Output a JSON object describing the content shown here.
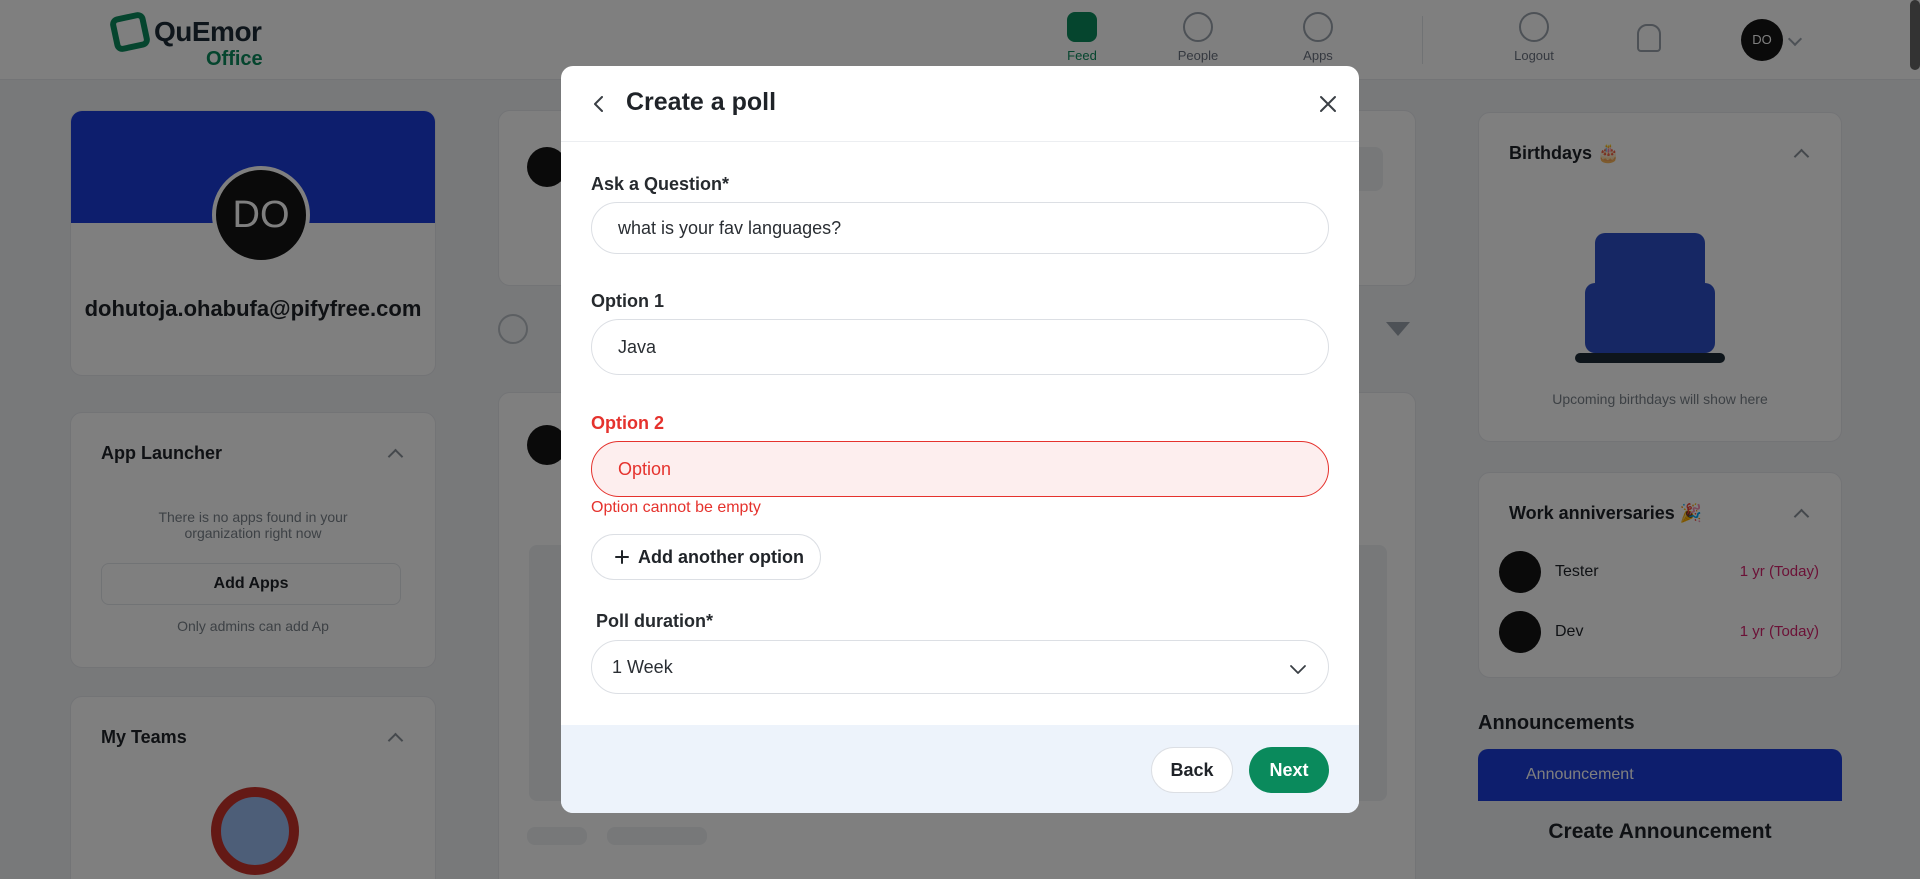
{
  "app": {
    "logo_name": "QuEmor",
    "logo_sub": "Office",
    "nav": [
      "Feed",
      "People",
      "Apps"
    ],
    "logout_label": "Logout",
    "user_initials": "DO"
  },
  "profile": {
    "initials": "DO",
    "email": "dohutoja.ohabufa@pifyfree.com"
  },
  "app_launcher": {
    "title": "App Launcher",
    "description": "There is no apps found in your organization right now",
    "button_label": "Add Apps",
    "note": "Only admins can add Ap"
  },
  "my_teams": {
    "title": "My Teams"
  },
  "birthdays": {
    "title": "Birthdays 🎂",
    "empty_text": "Upcoming birthdays will show here"
  },
  "work_anniversaries": {
    "title": "Work anniversaries 🎉",
    "rows": [
      {
        "name": "Tester",
        "date": "1 yr (Today)"
      },
      {
        "name": "Dev",
        "date": "1 yr (Today)"
      }
    ]
  },
  "announcements": {
    "heading": "Announcements",
    "tab_label": "Announcement",
    "create_label": "Create Announcement"
  },
  "modal": {
    "title": "Create a poll",
    "question": {
      "label": "Ask a Question*",
      "value": "what is your fav languages?"
    },
    "option1": {
      "label": "Option 1",
      "value": "Java"
    },
    "option2": {
      "label": "Option 2",
      "placeholder": "Option",
      "error": "Option cannot be empty"
    },
    "add_option_label": "Add another option",
    "duration": {
      "label": "Poll duration*",
      "selected": "1 Week"
    },
    "back_label": "Back",
    "next_label": "Next"
  },
  "colors": {
    "accent": "#0a8a5c",
    "error": "#e5322d",
    "footer_bg": "#edf3fb",
    "banner": "#1a3cdb"
  },
  "icons": {
    "back": "chevron-left-icon",
    "close": "close-icon",
    "add": "plus-icon",
    "dropdown": "chevron-down-icon"
  }
}
